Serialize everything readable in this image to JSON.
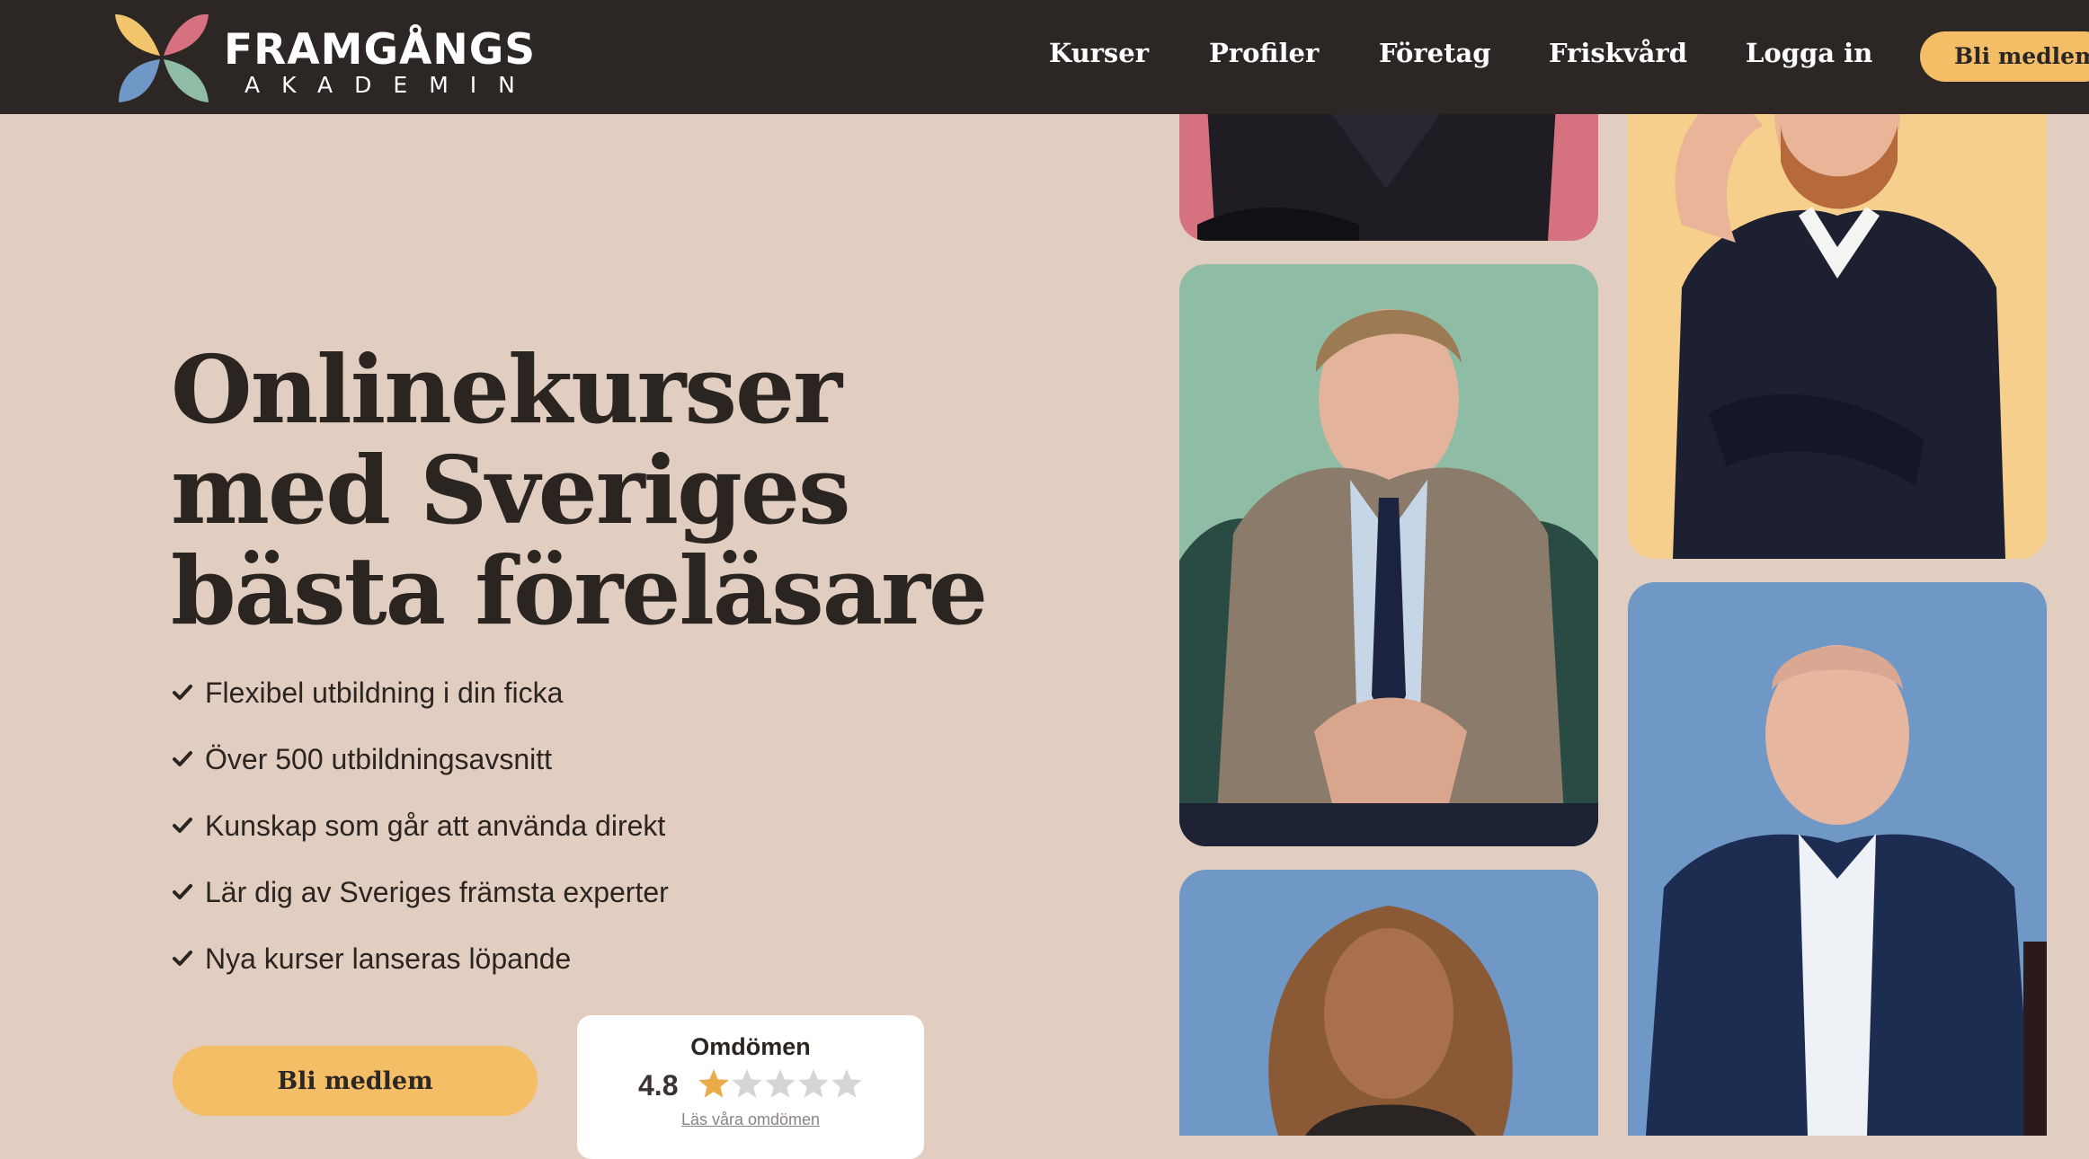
{
  "header": {
    "logo": {
      "name": "FRAMGÅNGS",
      "sub": "AKADEMIN"
    },
    "nav": [
      {
        "label": "Kurser"
      },
      {
        "label": "Profiler"
      },
      {
        "label": "Företag"
      },
      {
        "label": "Friskvård"
      },
      {
        "label": "Logga in"
      }
    ],
    "cta": "Bli medlem"
  },
  "hero": {
    "title_lines": [
      "Onlinekurser",
      "med Sveriges",
      "bästa föreläsare"
    ],
    "bullets": [
      "Flexibel utbildning i din ficka",
      "Över 500 utbildningsavsnitt",
      "Kunskap som går att använda direkt",
      "Lär dig av Sveriges främsta experter",
      "Nya kurser lanseras löpande"
    ],
    "cta": "Bli medlem"
  },
  "reviews": {
    "title": "Omdömen",
    "score": "4.8",
    "rating": 4.8,
    "max": 5,
    "link": "Läs våra omdömen"
  },
  "icons": {
    "check": "checkmark-icon",
    "star": "star-icon",
    "logo": "flower-logo-icon"
  },
  "colors": {
    "page_bg": "#e2cdc1",
    "header_bg": "#2c2725",
    "accent": "#f3be66",
    "tile_pink": "#d6727f",
    "tile_green": "#8fbca4",
    "tile_yellow": "#f6cf8c",
    "tile_blue": "#6f98c6"
  }
}
